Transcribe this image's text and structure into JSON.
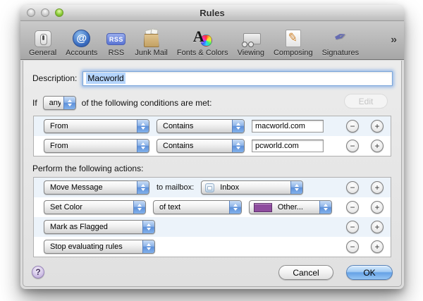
{
  "window": {
    "title": "Rules"
  },
  "toolbar": {
    "items": [
      {
        "label": "General"
      },
      {
        "label": "Accounts"
      },
      {
        "label": "RSS"
      },
      {
        "label": "Junk Mail"
      },
      {
        "label": "Fonts & Colors"
      },
      {
        "label": "Viewing"
      },
      {
        "label": "Composing"
      },
      {
        "label": "Signatures"
      }
    ],
    "rss_badge": "RSS",
    "accounts_glyph": "@",
    "fonts_glyph": "A",
    "composing_glyph": "✎",
    "signatures_glyph": "✒",
    "overflow": "»"
  },
  "sheet": {
    "description_label": "Description:",
    "description_value": "Macworld",
    "if_label": "If",
    "match_quantifier": "any",
    "conditions_caption": "of the following conditions are met:",
    "conditions": [
      {
        "field": "From",
        "operator": "Contains",
        "value": "macworld.com"
      },
      {
        "field": "From",
        "operator": "Contains",
        "value": "pcworld.com"
      }
    ],
    "actions_caption": "Perform the following actions:",
    "actions": {
      "move": {
        "type": "Move Message",
        "to_label": "to mailbox:",
        "mailbox": "Inbox"
      },
      "color": {
        "type": "Set Color",
        "target": "of text",
        "value": "Other...",
        "swatch": "#8e4c9e"
      },
      "flag": {
        "type": "Mark as Flagged"
      },
      "stop": {
        "type": "Stop evaluating rules"
      }
    },
    "ghost_edit_label": "Edit",
    "controls": {
      "minus": "−",
      "plus": "+"
    },
    "help_label": "?",
    "cancel_label": "Cancel",
    "ok_label": "OK",
    "accent_blue": "#6ca0e7",
    "row_tint": "#ecf3fa"
  }
}
